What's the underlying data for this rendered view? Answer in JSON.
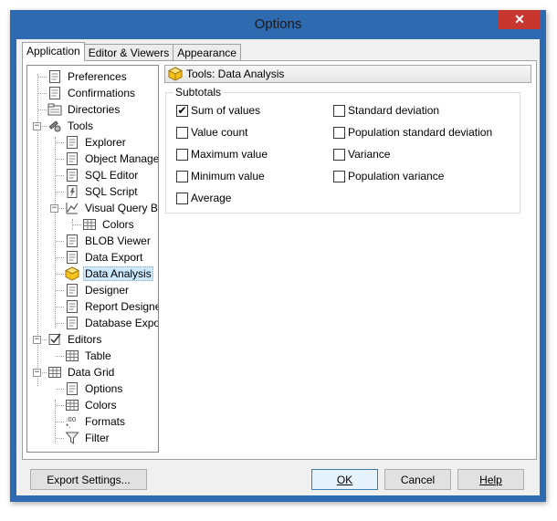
{
  "window": {
    "title": "Options",
    "close_glyph": "✕"
  },
  "tabs": [
    {
      "label": "Application",
      "active": true
    },
    {
      "label": "Editor & Viewers",
      "active": false
    },
    {
      "label": "Appearance",
      "active": false
    }
  ],
  "tree": [
    {
      "label": "Preferences",
      "icon": "preferences-icon"
    },
    {
      "label": "Confirmations",
      "icon": "confirmations-icon"
    },
    {
      "label": "Directories",
      "icon": "directories-icon"
    },
    {
      "label": "Tools",
      "icon": "tools-icon",
      "expander": "−"
    },
    {
      "label": "Explorer",
      "icon": "explorer-icon"
    },
    {
      "label": "Object Manager",
      "icon": "object-manager-icon"
    },
    {
      "label": "SQL Editor",
      "icon": "sql-editor-icon"
    },
    {
      "label": "SQL Script",
      "icon": "sql-script-icon"
    },
    {
      "label": "Visual Query Buil",
      "icon": "visual-query-builder-icon",
      "expander": "−"
    },
    {
      "label": "Colors",
      "icon": "colors-icon"
    },
    {
      "label": "BLOB Viewer",
      "icon": "blob-viewer-icon"
    },
    {
      "label": "Data Export",
      "icon": "data-export-icon"
    },
    {
      "label": "Data Analysis",
      "icon": "data-analysis-icon",
      "selected": true
    },
    {
      "label": "Designer",
      "icon": "designer-icon"
    },
    {
      "label": "Report Designer",
      "icon": "report-designer-icon"
    },
    {
      "label": "Database Export",
      "icon": "database-export-icon"
    },
    {
      "label": "Editors",
      "icon": "editors-icon",
      "expander": "−"
    },
    {
      "label": "Table",
      "icon": "table-icon"
    },
    {
      "label": "Data Grid",
      "icon": "data-grid-icon",
      "expander": "−"
    },
    {
      "label": "Options",
      "icon": "options-icon"
    },
    {
      "label": "Colors",
      "icon": "colors-icon"
    },
    {
      "label": "Formats",
      "icon": "formats-icon"
    },
    {
      "label": "Filter",
      "icon": "filter-icon"
    }
  ],
  "section_header": {
    "label": "Tools: Data Analysis",
    "icon": "data-analysis-icon"
  },
  "subtotals": {
    "title": "Subtotals",
    "left": [
      {
        "label": "Sum of values",
        "checked": true
      },
      {
        "label": "Value count",
        "checked": false
      },
      {
        "label": "Maximum value",
        "checked": false
      },
      {
        "label": "Minimum value",
        "checked": false
      },
      {
        "label": "Average",
        "checked": false
      }
    ],
    "right": [
      {
        "label": "Standard deviation",
        "checked": false
      },
      {
        "label": "Population standard deviation",
        "checked": false
      },
      {
        "label": "Variance",
        "checked": false
      },
      {
        "label": "Population variance",
        "checked": false
      }
    ]
  },
  "buttons": {
    "export_settings": "Export Settings...",
    "ok": "OK",
    "cancel": "Cancel",
    "help": "Help"
  },
  "colors": {
    "title_bar": "#2d6ab0",
    "close_button": "#c7372f",
    "selection": "#cce8ff"
  }
}
